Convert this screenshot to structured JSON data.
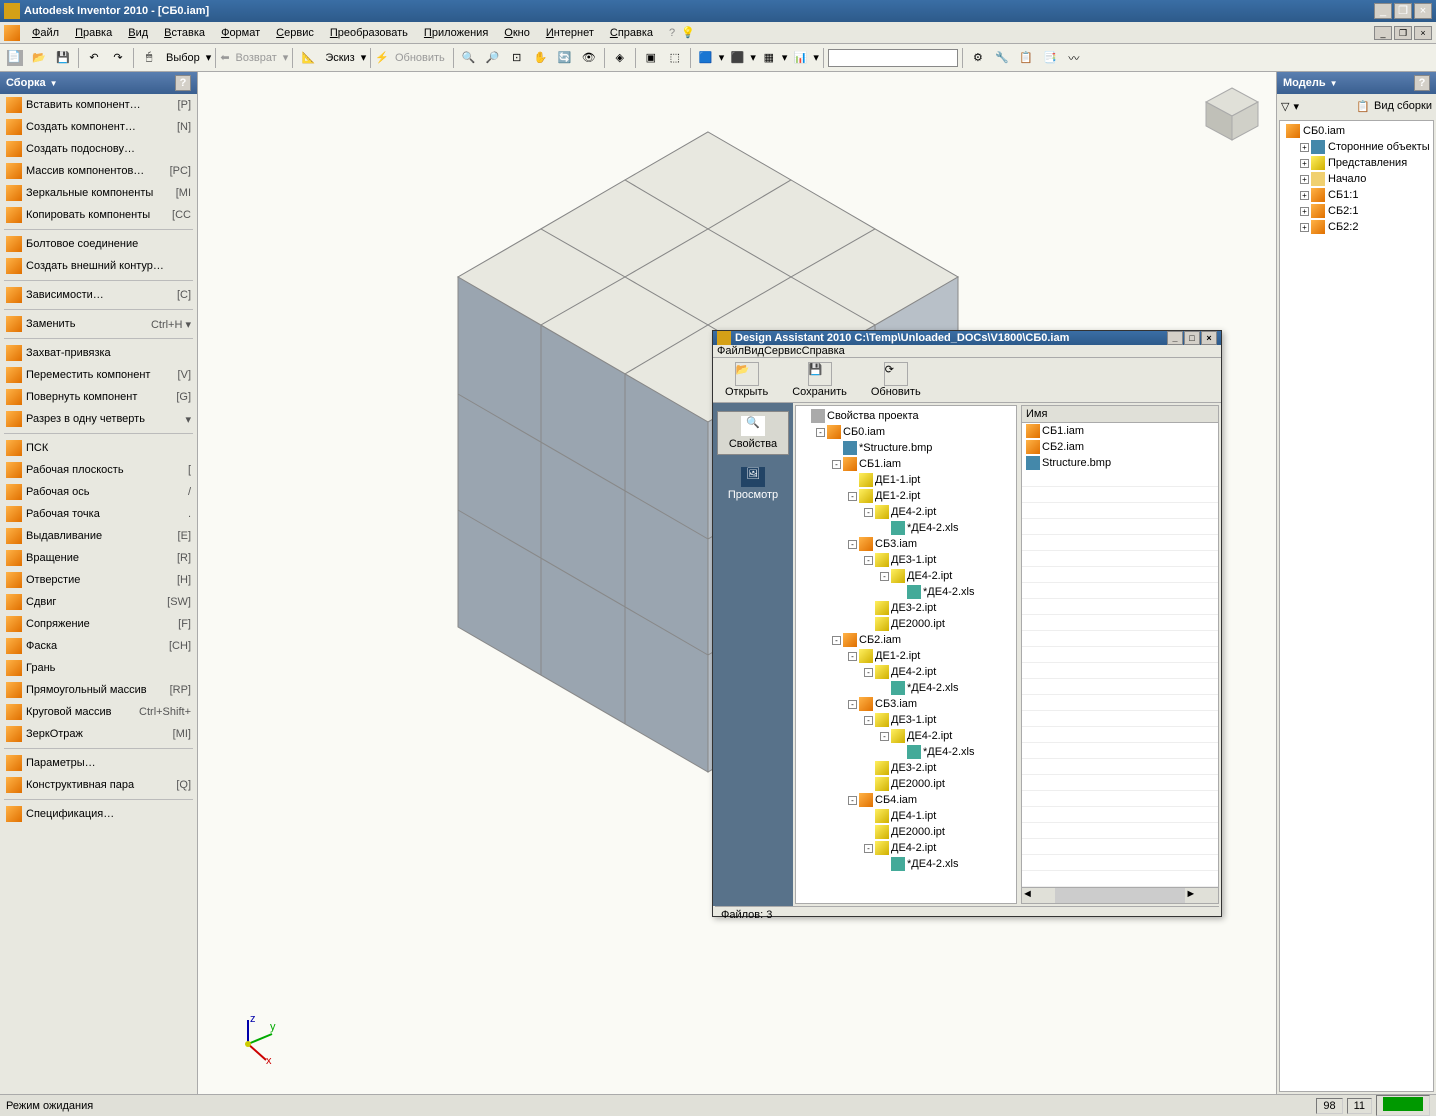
{
  "app": {
    "title": "Autodesk Inventor 2010 - [СБ0.iam]"
  },
  "menu": [
    "Файл",
    "Правка",
    "Вид",
    "Вставка",
    "Формат",
    "Сервис",
    "Преобразовать",
    "Приложения",
    "Окно",
    "Интернет",
    "Справка"
  ],
  "toolbar": {
    "select_label": "Выбор",
    "return_label": "Возврат",
    "sketch_label": "Эскиз",
    "update_label": "Обновить"
  },
  "sidebar": {
    "title": "Сборка",
    "items": [
      {
        "label": "Вставить компонент…",
        "shortcut": "[P]"
      },
      {
        "label": "Создать компонент…",
        "shortcut": "[N]"
      },
      {
        "label": "Создать подоснову…",
        "shortcut": ""
      },
      {
        "label": "Массив компонентов…",
        "shortcut": "[PC]"
      },
      {
        "label": "Зеркальные компоненты",
        "shortcut": "[MI"
      },
      {
        "label": "Копировать компоненты",
        "shortcut": "[CC"
      },
      {
        "sep": true
      },
      {
        "label": "Болтовое соединение",
        "shortcut": ""
      },
      {
        "label": "Создать внешний контур…",
        "shortcut": ""
      },
      {
        "sep": true
      },
      {
        "label": "Зависимости…",
        "shortcut": "[C]"
      },
      {
        "sep": true
      },
      {
        "label": "Заменить",
        "shortcut": "Ctrl+H  ▾"
      },
      {
        "sep": true
      },
      {
        "label": "Захват-привязка",
        "shortcut": ""
      },
      {
        "label": "Переместить компонент",
        "shortcut": "[V]"
      },
      {
        "label": "Повернуть компонент",
        "shortcut": "[G]"
      },
      {
        "label": "Разрез в одну четверть",
        "shortcut": "▾"
      },
      {
        "sep": true
      },
      {
        "label": "ПСК",
        "shortcut": ""
      },
      {
        "label": "Рабочая плоскость",
        "shortcut": "["
      },
      {
        "label": "Рабочая ось",
        "shortcut": "/"
      },
      {
        "label": "Рабочая точка",
        "shortcut": "."
      },
      {
        "label": "Выдавливание",
        "shortcut": "[E]"
      },
      {
        "label": "Вращение",
        "shortcut": "[R]"
      },
      {
        "label": "Отверстие",
        "shortcut": "[H]"
      },
      {
        "label": "Сдвиг",
        "shortcut": "[SW]"
      },
      {
        "label": "Сопряжение",
        "shortcut": "[F]"
      },
      {
        "label": "Фаска",
        "shortcut": "[CH]"
      },
      {
        "label": "Грань",
        "shortcut": ""
      },
      {
        "label": "Прямоугольный массив",
        "shortcut": "[RP]"
      },
      {
        "label": "Круговой массив",
        "shortcut": "Ctrl+Shift+"
      },
      {
        "label": "ЗеркОтраж",
        "shortcut": "[MI]"
      },
      {
        "sep": true
      },
      {
        "label": "Параметры…",
        "shortcut": ""
      },
      {
        "label": "Конструктивная пара",
        "shortcut": "[Q]"
      },
      {
        "sep": true
      },
      {
        "label": "Спецификация…",
        "shortcut": ""
      }
    ]
  },
  "model_panel": {
    "title": "Модель",
    "view_label": "Вид сборки",
    "tree": [
      {
        "label": "СБ0.iam",
        "icon": "orange",
        "indent": 0,
        "expander": ""
      },
      {
        "label": "Сторонние объекты",
        "icon": "blue",
        "indent": 1,
        "expander": "+"
      },
      {
        "label": "Представления",
        "icon": "yellow",
        "indent": 1,
        "expander": "+"
      },
      {
        "label": "Начало",
        "icon": "folder",
        "indent": 1,
        "expander": "+"
      },
      {
        "label": "СБ1:1",
        "icon": "orange",
        "indent": 1,
        "expander": "+"
      },
      {
        "label": "СБ2:1",
        "icon": "orange",
        "indent": 1,
        "expander": "+"
      },
      {
        "label": "СБ2:2",
        "icon": "orange",
        "indent": 1,
        "expander": "+"
      }
    ]
  },
  "design_assistant": {
    "title": "Design Assistant 2010 C:\\Temp\\Unloaded_DOCs\\V1800\\СБ0.iam",
    "menu": [
      "Файл",
      "Вид",
      "Сервис",
      "Справка"
    ],
    "tb": {
      "open": "Открыть",
      "save": "Сохранить",
      "refresh": "Обновить"
    },
    "leftbtns": {
      "props": "Свойства",
      "preview": "Просмотр"
    },
    "status": "Файлов: 3",
    "right": {
      "header": "Имя",
      "items": [
        "СБ1.iam",
        "СБ2.iam",
        "Structure.bmp"
      ]
    },
    "tree": [
      {
        "label": "Свойства проекта",
        "icon": "gray",
        "indent": 0,
        "expander": ""
      },
      {
        "label": "СБ0.iam",
        "icon": "orange",
        "indent": 1,
        "expander": "-"
      },
      {
        "label": "*Structure.bmp",
        "icon": "blue",
        "indent": 2,
        "expander": ""
      },
      {
        "label": "СБ1.iam",
        "icon": "orange",
        "indent": 2,
        "expander": "-"
      },
      {
        "label": "ДЕ1-1.ipt",
        "icon": "yellow",
        "indent": 3,
        "expander": ""
      },
      {
        "label": "ДЕ1-2.ipt",
        "icon": "yellow",
        "indent": 3,
        "expander": "-"
      },
      {
        "label": "ДЕ4-2.ipt",
        "icon": "yellow",
        "indent": 4,
        "expander": "-"
      },
      {
        "label": "*ДЕ4-2.xls",
        "icon": "green",
        "indent": 5,
        "expander": ""
      },
      {
        "label": "СБ3.iam",
        "icon": "orange",
        "indent": 3,
        "expander": "-"
      },
      {
        "label": "ДЕ3-1.ipt",
        "icon": "yellow",
        "indent": 4,
        "expander": "-"
      },
      {
        "label": "ДЕ4-2.ipt",
        "icon": "yellow",
        "indent": 5,
        "expander": "-"
      },
      {
        "label": "*ДЕ4-2.xls",
        "icon": "green",
        "indent": 6,
        "expander": ""
      },
      {
        "label": "ДЕ3-2.ipt",
        "icon": "yellow",
        "indent": 4,
        "expander": ""
      },
      {
        "label": "ДЕ2000.ipt",
        "icon": "yellow",
        "indent": 4,
        "expander": ""
      },
      {
        "label": "СБ2.iam",
        "icon": "orange",
        "indent": 2,
        "expander": "-"
      },
      {
        "label": "ДЕ1-2.ipt",
        "icon": "yellow",
        "indent": 3,
        "expander": "-"
      },
      {
        "label": "ДЕ4-2.ipt",
        "icon": "yellow",
        "indent": 4,
        "expander": "-"
      },
      {
        "label": "*ДЕ4-2.xls",
        "icon": "green",
        "indent": 5,
        "expander": ""
      },
      {
        "label": "СБ3.iam",
        "icon": "orange",
        "indent": 3,
        "expander": "-"
      },
      {
        "label": "ДЕ3-1.ipt",
        "icon": "yellow",
        "indent": 4,
        "expander": "-"
      },
      {
        "label": "ДЕ4-2.ipt",
        "icon": "yellow",
        "indent": 5,
        "expander": "-"
      },
      {
        "label": "*ДЕ4-2.xls",
        "icon": "green",
        "indent": 6,
        "expander": ""
      },
      {
        "label": "ДЕ3-2.ipt",
        "icon": "yellow",
        "indent": 4,
        "expander": ""
      },
      {
        "label": "ДЕ2000.ipt",
        "icon": "yellow",
        "indent": 4,
        "expander": ""
      },
      {
        "label": "СБ4.iam",
        "icon": "orange",
        "indent": 3,
        "expander": "-"
      },
      {
        "label": "ДЕ4-1.ipt",
        "icon": "yellow",
        "indent": 4,
        "expander": ""
      },
      {
        "label": "ДЕ2000.ipt",
        "icon": "yellow",
        "indent": 4,
        "expander": ""
      },
      {
        "label": "ДЕ4-2.ipt",
        "icon": "yellow",
        "indent": 4,
        "expander": "-"
      },
      {
        "label": "*ДЕ4-2.xls",
        "icon": "green",
        "indent": 5,
        "expander": ""
      }
    ]
  },
  "status": {
    "text": "Режим ожидания",
    "num1": "98",
    "num2": "11"
  },
  "axes": {
    "x": "x",
    "y": "y",
    "z": "z"
  }
}
